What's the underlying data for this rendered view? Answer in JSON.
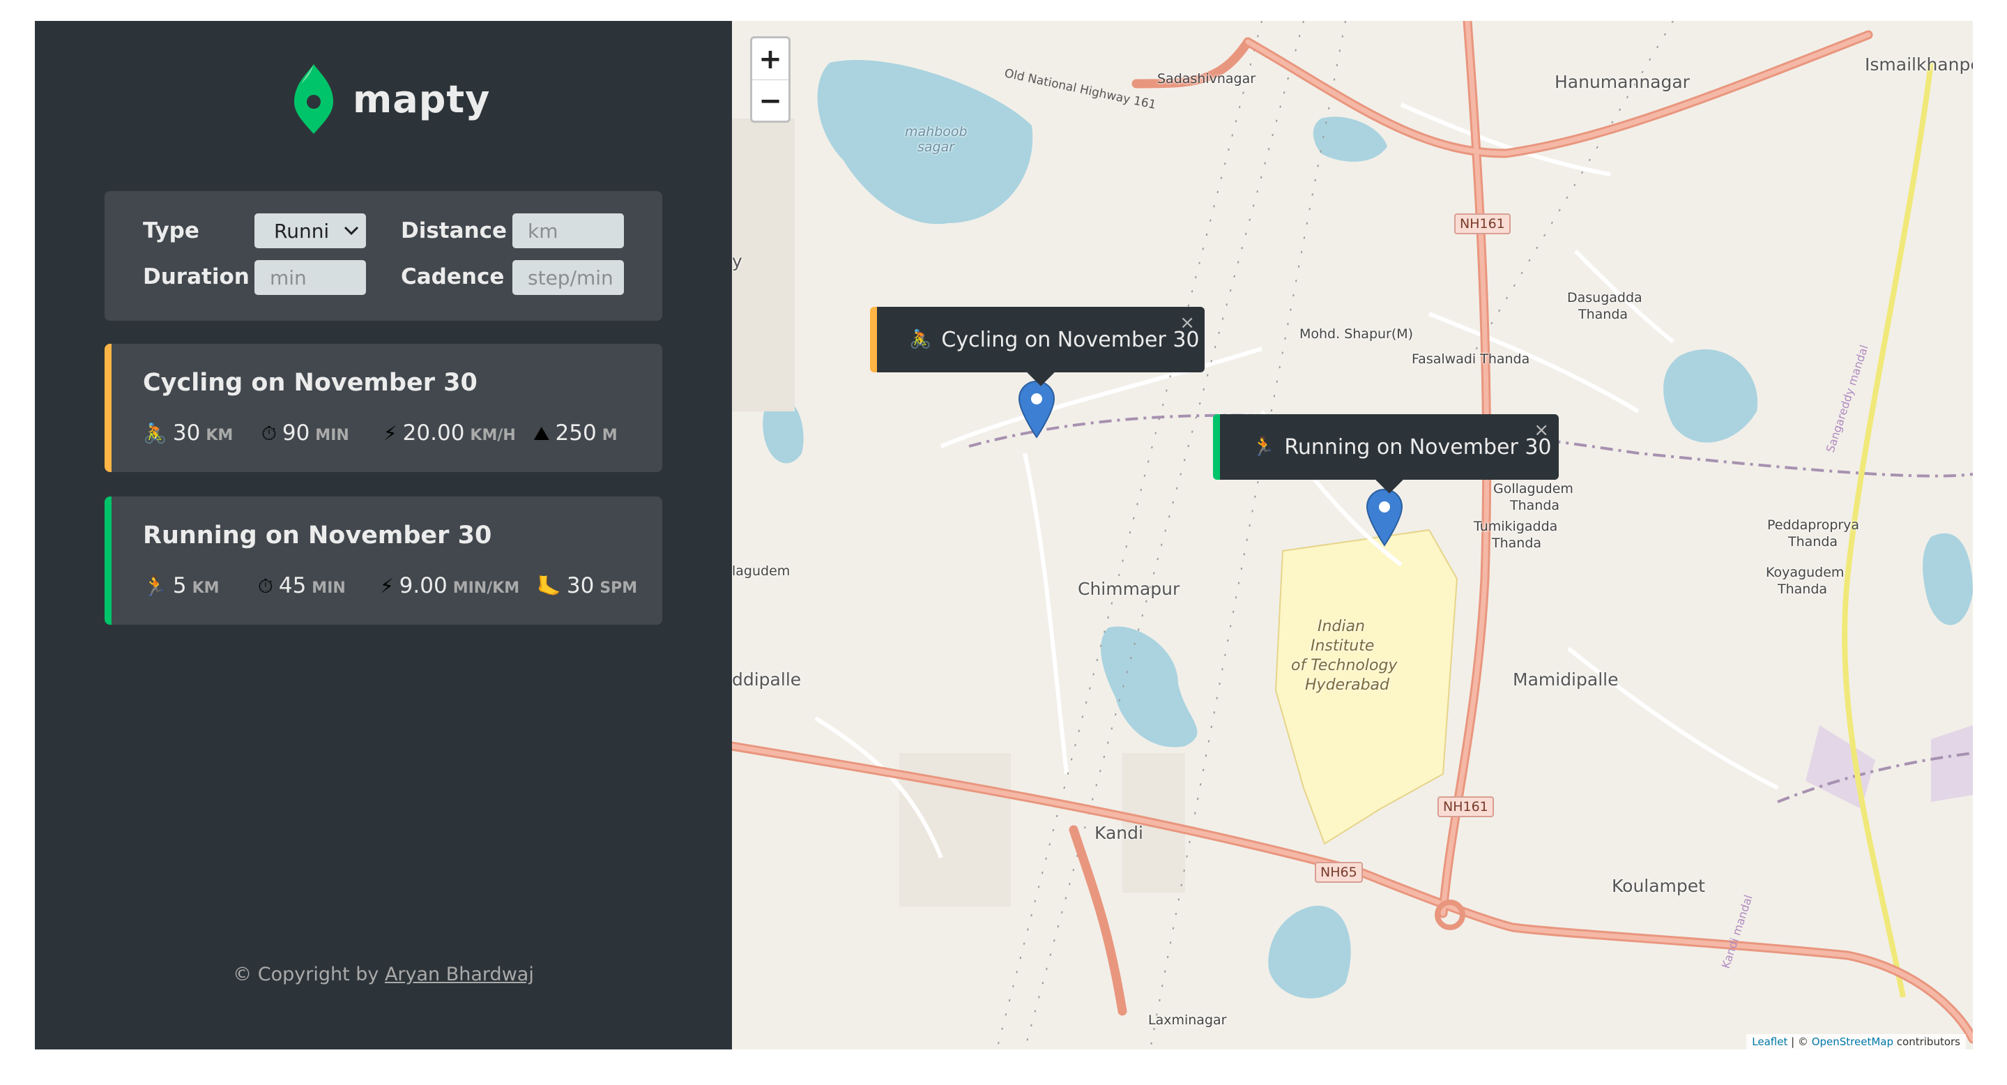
{
  "brand": {
    "name": "mapty",
    "logo_color": "#00c46a"
  },
  "form": {
    "type_label": "Type",
    "type_value": "Runni",
    "distance_label": "Distance",
    "distance_placeholder": "km",
    "duration_label": "Duration",
    "duration_placeholder": "min",
    "cadence_label": "Cadence",
    "cadence_placeholder": "step/min"
  },
  "workouts": [
    {
      "type": "cycling",
      "accent": "#ffb545",
      "title": "Cycling on November 30",
      "details": [
        {
          "icon": "🚴",
          "icon_name": "cycling-icon",
          "value": "30",
          "unit": "KM"
        },
        {
          "icon": "⏱",
          "icon_name": "stopwatch-icon",
          "value": "90",
          "unit": "MIN"
        },
        {
          "icon": "⚡",
          "icon_name": "lightning-icon",
          "value": "20.00",
          "unit": "KM/H"
        },
        {
          "icon": "⛰",
          "icon_name": "mountain-icon",
          "value": "250",
          "unit": "M"
        }
      ]
    },
    {
      "type": "running",
      "accent": "#00c46a",
      "title": "Running on November 30",
      "details": [
        {
          "icon": "🏃",
          "icon_name": "running-icon",
          "value": "5",
          "unit": "KM"
        },
        {
          "icon": "⏱",
          "icon_name": "stopwatch-icon",
          "value": "45",
          "unit": "MIN"
        },
        {
          "icon": "⚡",
          "icon_name": "lightning-icon",
          "value": "9.00",
          "unit": "MIN/KM"
        },
        {
          "icon": "🦶",
          "icon_name": "footprint-icon",
          "value": "30",
          "unit": "SPM"
        }
      ]
    }
  ],
  "copyright": {
    "prefix": "© Copyright by ",
    "author": "Aryan Bhardwaj"
  },
  "map": {
    "zoom_in": "+",
    "zoom_out": "−",
    "popups": [
      {
        "type": "cycling",
        "icon": "🚴",
        "text": "Cycling on November 30",
        "close": "×"
      },
      {
        "type": "running",
        "icon": "🏃",
        "text": "Running on November 30",
        "close": "×"
      }
    ],
    "places": {
      "sadashivnagar": "Sadashivnagar",
      "hanumannagar": "Hanumannagar",
      "ismailkhanpet": "Ismailkhanpe",
      "mahboob_sagar_1": "mahboob",
      "mahboob_sagar_2": "sagar",
      "dasugadda_1": "Dasugadda",
      "dasugadda_2": "Thanda",
      "mohd_shapur": "Mohd. Shapur(M)",
      "fasalwadi": "Fasalwadi Thanda",
      "gollagudem_1": "Gollagudem",
      "gollagudem_2": "Thanda",
      "tumikigadda_1": "Tumikigadda",
      "tumikigadda_2": "Thanda",
      "peddaproprya_1": "Peddaproprya",
      "peddaproprya_2": "Thanda",
      "koyagudem_1": "Koyagudem",
      "koyagudem_2": "Thanda",
      "chimmapur": "Chimmapur",
      "iith_1": "Indian",
      "iith_2": "Institute",
      "iith_3": "of Technology",
      "iith_4": "Hyderabad",
      "mamidipalle": "Mamidipalle",
      "kandi": "Kandi",
      "koulampet": "Koulampet",
      "laxminagar": "Laxminagar",
      "dipalle": "ddipalle",
      "lagudem": "lagudem",
      "y_edge": "y",
      "old_highway": "Old National Highway 161",
      "sangareddy_kandi": "Sangareddy mandal",
      "kandi_mandal": "Kandi mandal"
    },
    "shields": {
      "nh161_top": "NH161",
      "nh161_bottom": "NH161",
      "nh65": "NH65"
    },
    "attribution": {
      "leaflet": "Leaflet",
      "sep": " | © ",
      "osm": "OpenStreetMap",
      "suffix": " contributors"
    }
  }
}
